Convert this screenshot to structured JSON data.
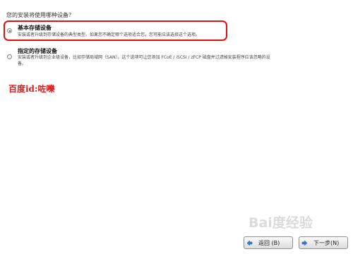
{
  "installer": {
    "question": "您的安装将使用哪种设备？",
    "options": [
      {
        "title": "基本存储设备",
        "description": "安装或者升级到存储设备的典型类型。如果您不确定哪个选项适合您，您可能应该选择这个选项。",
        "selected": true
      },
      {
        "title": "指定的存储设备",
        "description": "安装或者升级到企业级设备，比如存储局域网（SAN）。这个选项可让您添加 FCoE / iSCSI / zFCP 磁盘并过滤掉安装程序应该忽略的设备。",
        "selected": false
      }
    ]
  },
  "annotation": {
    "note": "百度id:咗嚛",
    "highlight_color": "#e01010"
  },
  "watermark": {
    "text": "Bai度经验"
  },
  "buttons": {
    "back_label": "返回 (B)",
    "next_label": "下一步(N)"
  },
  "icons": {
    "back": "arrow-left-icon",
    "next": "arrow-right-icon"
  }
}
